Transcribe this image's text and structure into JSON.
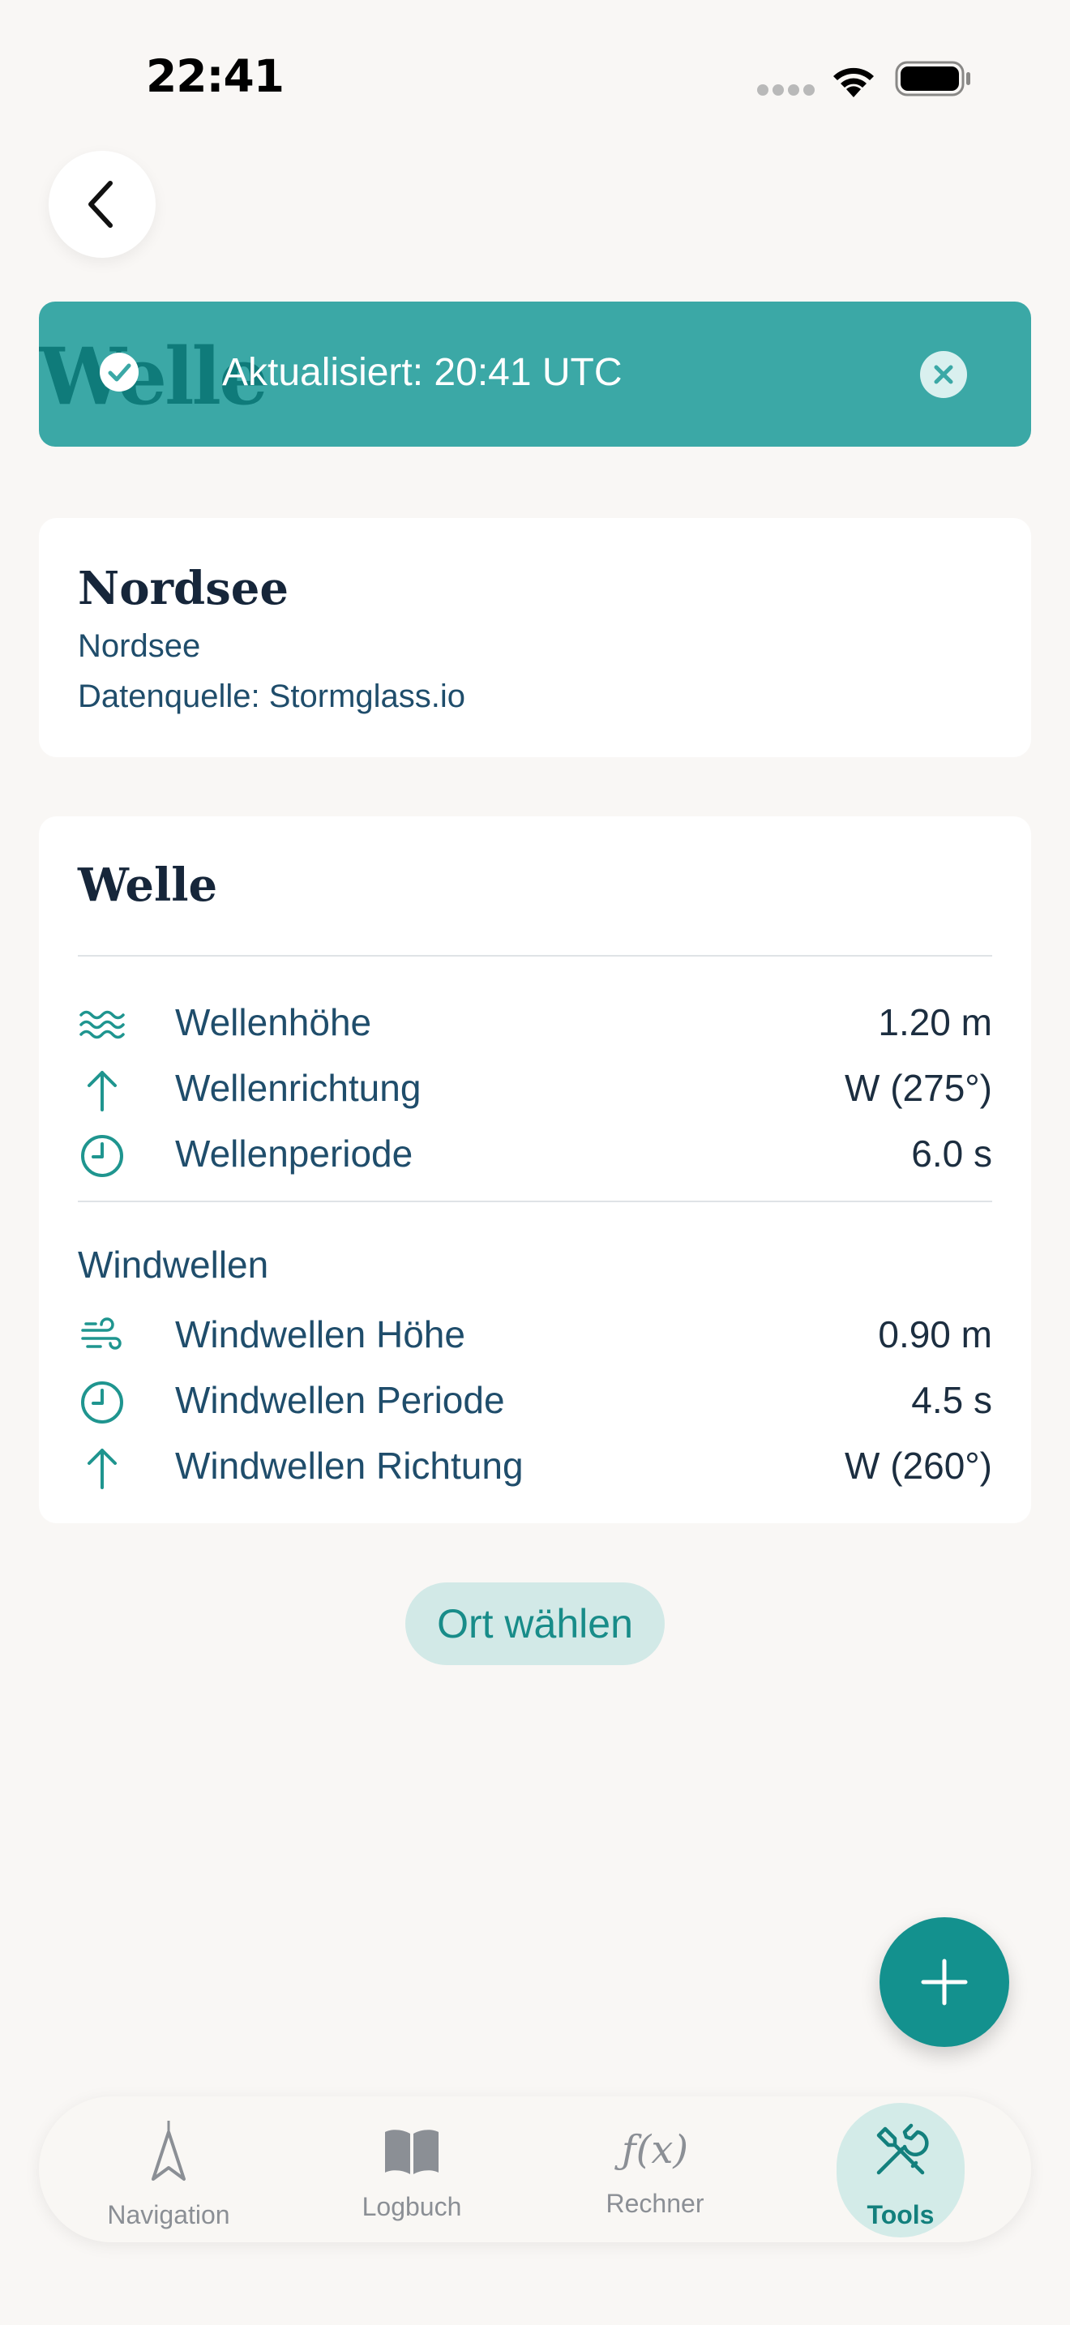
{
  "status_bar": {
    "time": "22:41",
    "wifi_icon": "wifi-icon",
    "battery_icon": "battery-icon"
  },
  "nav": {
    "back_icon": "chevron-left-icon"
  },
  "toast": {
    "background_title": "Welle",
    "message": "Aktualisiert: 20:41 UTC",
    "check_icon": "check-circle-icon",
    "close_icon": "close-icon",
    "color": "#3ba8a6"
  },
  "location": {
    "title": "Nordsee",
    "subtitle": "Nordsee",
    "source": "Datenquelle: Stormglass.io"
  },
  "wave": {
    "title": "Welle",
    "rows": [
      {
        "icon": "waves-icon",
        "label": "Wellenhöhe",
        "value": "1.20 m"
      },
      {
        "icon": "arrow-up-icon",
        "label": "Wellenrichtung",
        "value": "W (275°)"
      },
      {
        "icon": "clock-icon",
        "label": "Wellenperiode",
        "value": "6.0 s"
      }
    ],
    "wind_section_label": "Windwellen",
    "wind_rows": [
      {
        "icon": "wind-icon",
        "label": "Windwellen Höhe",
        "value": "0.90 m"
      },
      {
        "icon": "clock-icon",
        "label": "Windwellen Periode",
        "value": "4.5 s"
      },
      {
        "icon": "arrow-up-icon",
        "label": "Windwellen Richtung",
        "value": "W (260°)"
      }
    ]
  },
  "actions": {
    "choose_location": "Ort wählen",
    "fab_icon": "plus-icon"
  },
  "tabbar": {
    "tabs": [
      {
        "label": "Navigation",
        "icon": "navigation-arrow-icon",
        "active": false
      },
      {
        "label": "Logbuch",
        "icon": "book-icon",
        "active": false
      },
      {
        "label": "Rechner",
        "icon": "function-icon",
        "glyph": "ƒ(x)",
        "active": false
      },
      {
        "label": "Tools",
        "icon": "tools-icon",
        "active": true
      }
    ]
  },
  "colors": {
    "accent": "#13918e",
    "accent_light": "#d3ebe8",
    "text_primary": "#16263a",
    "text_secondary": "#1f4d6b",
    "background": "#f9f7f5"
  }
}
